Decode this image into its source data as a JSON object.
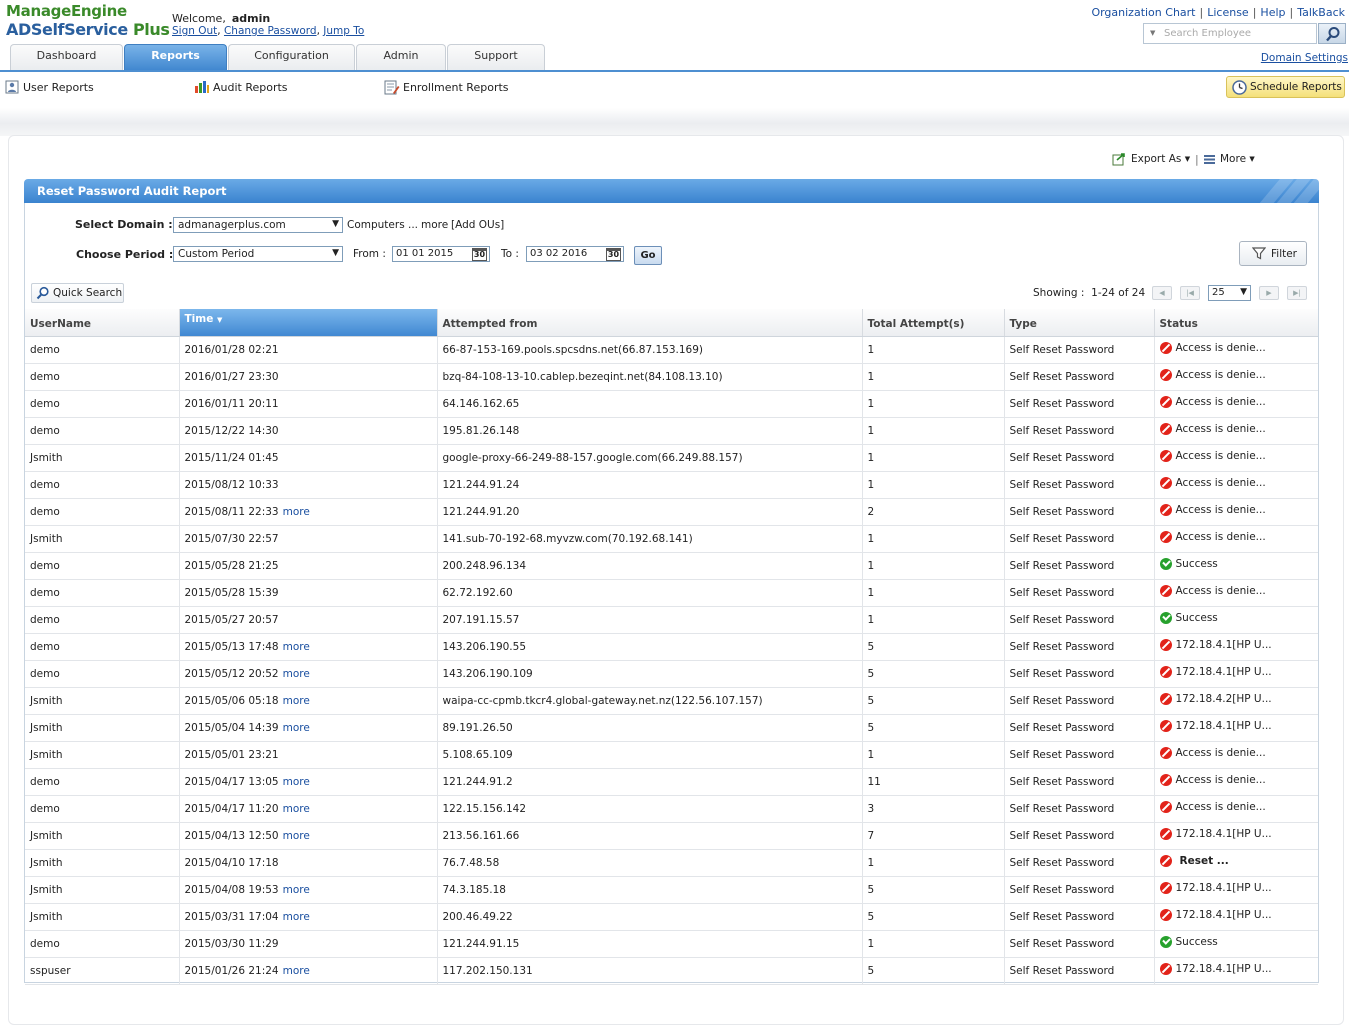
{
  "header": {
    "brand_top": "ManageEngine",
    "product_name_a": "ADSelfService",
    "product_name_b": "Plus",
    "welcome_text": "Welcome,",
    "username": "admin",
    "sign_out": "Sign Out",
    "change_password": "Change Password",
    "jump_to": "Jump To",
    "top_links": [
      "Organization Chart",
      "License",
      "Help",
      "TalkBack"
    ],
    "search_placeholder": "Search Employee",
    "domain_settings": "Domain Settings"
  },
  "tabs": [
    {
      "label": "Dashboard",
      "active": false
    },
    {
      "label": "Reports",
      "active": true
    },
    {
      "label": "Configuration",
      "active": false
    },
    {
      "label": "Admin",
      "active": false
    },
    {
      "label": "Support",
      "active": false
    }
  ],
  "subnav": {
    "user_reports": "User Reports",
    "audit_reports": "Audit Reports",
    "enrollment_reports": "Enrollment Reports",
    "schedule_reports": "Schedule Reports"
  },
  "toolbar": {
    "export_as": "Export As",
    "more": "More"
  },
  "report": {
    "title": "Reset Password Audit Report",
    "select_domain_label": "Select Domain :",
    "domain_value": "admanagerplus.com",
    "computers_text": "Computers ...",
    "more_link": "more",
    "add_ous": "[Add OUs]",
    "choose_period_label": "Choose Period :",
    "period_value": "Custom Period",
    "from_label": "From :",
    "from_value": "01 01 2015",
    "to_label": "To :",
    "to_value": "03 02 2016",
    "calendar_day": "30",
    "go_label": "Go",
    "filter_label": "Filter",
    "quick_search": "Quick Search",
    "showing_label": "Showing :",
    "showing_range": "1-24 of 24",
    "page_size": "25"
  },
  "table": {
    "columns": [
      "UserName",
      "Time",
      "Attempted from",
      "Total Attempt(s)",
      "Type",
      "Status"
    ],
    "more_label": "more",
    "rows": [
      {
        "user": "demo",
        "time": "2016/01/28 02:21",
        "more": false,
        "from": "66-87-153-169.pools.spcsdns.net(66.87.153.169)",
        "attempts": "1",
        "type": "Self Reset Password",
        "status": "Access is denie...",
        "status_kind": "denied"
      },
      {
        "user": "demo",
        "time": "2016/01/27 23:30",
        "more": false,
        "from": "bzq-84-108-13-10.cablep.bezeqint.net(84.108.13.10)",
        "attempts": "1",
        "type": "Self Reset Password",
        "status": "Access is denie...",
        "status_kind": "denied"
      },
      {
        "user": "demo",
        "time": "2016/01/11 20:11",
        "more": false,
        "from": "64.146.162.65",
        "attempts": "1",
        "type": "Self Reset Password",
        "status": "Access is denie...",
        "status_kind": "denied"
      },
      {
        "user": "demo",
        "time": "2015/12/22 14:30",
        "more": false,
        "from": "195.81.26.148",
        "attempts": "1",
        "type": "Self Reset Password",
        "status": "Access is denie...",
        "status_kind": "denied"
      },
      {
        "user": "Jsmith",
        "time": "2015/11/24 01:45",
        "more": false,
        "from": "google-proxy-66-249-88-157.google.com(66.249.88.157)",
        "attempts": "1",
        "type": "Self Reset Password",
        "status": "Access is denie...",
        "status_kind": "denied"
      },
      {
        "user": "demo",
        "time": "2015/08/12 10:33",
        "more": false,
        "from": "121.244.91.24",
        "attempts": "1",
        "type": "Self Reset Password",
        "status": "Access is denie...",
        "status_kind": "denied"
      },
      {
        "user": "demo",
        "time": "2015/08/11 22:33",
        "more": true,
        "from": "121.244.91.20",
        "attempts": "2",
        "type": "Self Reset Password",
        "status": "Access is denie...",
        "status_kind": "denied"
      },
      {
        "user": "Jsmith",
        "time": "2015/07/30 22:57",
        "more": false,
        "from": "141.sub-70-192-68.myvzw.com(70.192.68.141)",
        "attempts": "1",
        "type": "Self Reset Password",
        "status": "Access is denie...",
        "status_kind": "denied"
      },
      {
        "user": "demo",
        "time": "2015/05/28 21:25",
        "more": false,
        "from": "200.248.96.134",
        "attempts": "1",
        "type": "Self Reset Password",
        "status": "Success",
        "status_kind": "success"
      },
      {
        "user": "demo",
        "time": "2015/05/28 15:39",
        "more": false,
        "from": "62.72.192.60",
        "attempts": "1",
        "type": "Self Reset Password",
        "status": "Access is denie...",
        "status_kind": "denied"
      },
      {
        "user": "demo",
        "time": "2015/05/27 20:57",
        "more": false,
        "from": "207.191.15.57",
        "attempts": "1",
        "type": "Self Reset Password",
        "status": "Success",
        "status_kind": "success"
      },
      {
        "user": "demo",
        "time": "2015/05/13 17:48",
        "more": true,
        "from": "143.206.190.55",
        "attempts": "5",
        "type": "Self Reset Password",
        "status": "172.18.4.1[HP U...",
        "status_kind": "denied"
      },
      {
        "user": "demo",
        "time": "2015/05/12 20:52",
        "more": true,
        "from": "143.206.190.109",
        "attempts": "5",
        "type": "Self Reset Password",
        "status": "172.18.4.1[HP U...",
        "status_kind": "denied"
      },
      {
        "user": "Jsmith",
        "time": "2015/05/06 05:18",
        "more": true,
        "from": "waipa-cc-cpmb.tkcr4.global-gateway.net.nz(122.56.107.157)",
        "attempts": "5",
        "type": "Self Reset Password",
        "status": "172.18.4.2[HP U...",
        "status_kind": "denied"
      },
      {
        "user": "Jsmith",
        "time": "2015/05/04 14:39",
        "more": true,
        "from": "89.191.26.50",
        "attempts": "5",
        "type": "Self Reset Password",
        "status": "172.18.4.1[HP U...",
        "status_kind": "denied"
      },
      {
        "user": "Jsmith",
        "time": "2015/05/01 23:21",
        "more": false,
        "from": "5.108.65.109",
        "attempts": "1",
        "type": "Self Reset Password",
        "status": "Access is denie...",
        "status_kind": "denied"
      },
      {
        "user": "demo",
        "time": "2015/04/17 13:05",
        "more": true,
        "from": "121.244.91.2",
        "attempts": "11",
        "type": "Self Reset Password",
        "status": "Access is denie...",
        "status_kind": "denied"
      },
      {
        "user": "demo",
        "time": "2015/04/17 11:20",
        "more": true,
        "from": "122.15.156.142",
        "attempts": "3",
        "type": "Self Reset Password",
        "status": "Access is denie...",
        "status_kind": "denied"
      },
      {
        "user": "Jsmith",
        "time": "2015/04/13 12:50",
        "more": true,
        "from": "213.56.161.66",
        "attempts": "7",
        "type": "Self Reset Password",
        "status": "172.18.4.1[HP U...",
        "status_kind": "denied"
      },
      {
        "user": "Jsmith",
        "time": "2015/04/10 17:18",
        "more": false,
        "from": "76.7.48.58",
        "attempts": "1",
        "type": "Self Reset Password",
        "status": "Reset ...",
        "status_kind": "reset"
      },
      {
        "user": "Jsmith",
        "time": "2015/04/08 19:53",
        "more": true,
        "from": "74.3.185.18",
        "attempts": "5",
        "type": "Self Reset Password",
        "status": "172.18.4.1[HP U...",
        "status_kind": "denied"
      },
      {
        "user": "Jsmith",
        "time": "2015/03/31 17:04",
        "more": true,
        "from": "200.46.49.22",
        "attempts": "5",
        "type": "Self Reset Password",
        "status": "172.18.4.1[HP U...",
        "status_kind": "denied"
      },
      {
        "user": "demo",
        "time": "2015/03/30 11:29",
        "more": false,
        "from": "121.244.91.15",
        "attempts": "1",
        "type": "Self Reset Password",
        "status": "Success",
        "status_kind": "success"
      },
      {
        "user": "sspuser",
        "time": "2015/01/26 21:24",
        "more": true,
        "from": "117.202.150.131",
        "attempts": "5",
        "type": "Self Reset Password",
        "status": "172.18.4.1[HP U...",
        "status_kind": "denied"
      }
    ]
  },
  "colors": {
    "accent_blue": "#3f86cf",
    "link_blue": "#1a4fa0",
    "denied_red": "#e2231a",
    "success_green": "#27a12d"
  }
}
